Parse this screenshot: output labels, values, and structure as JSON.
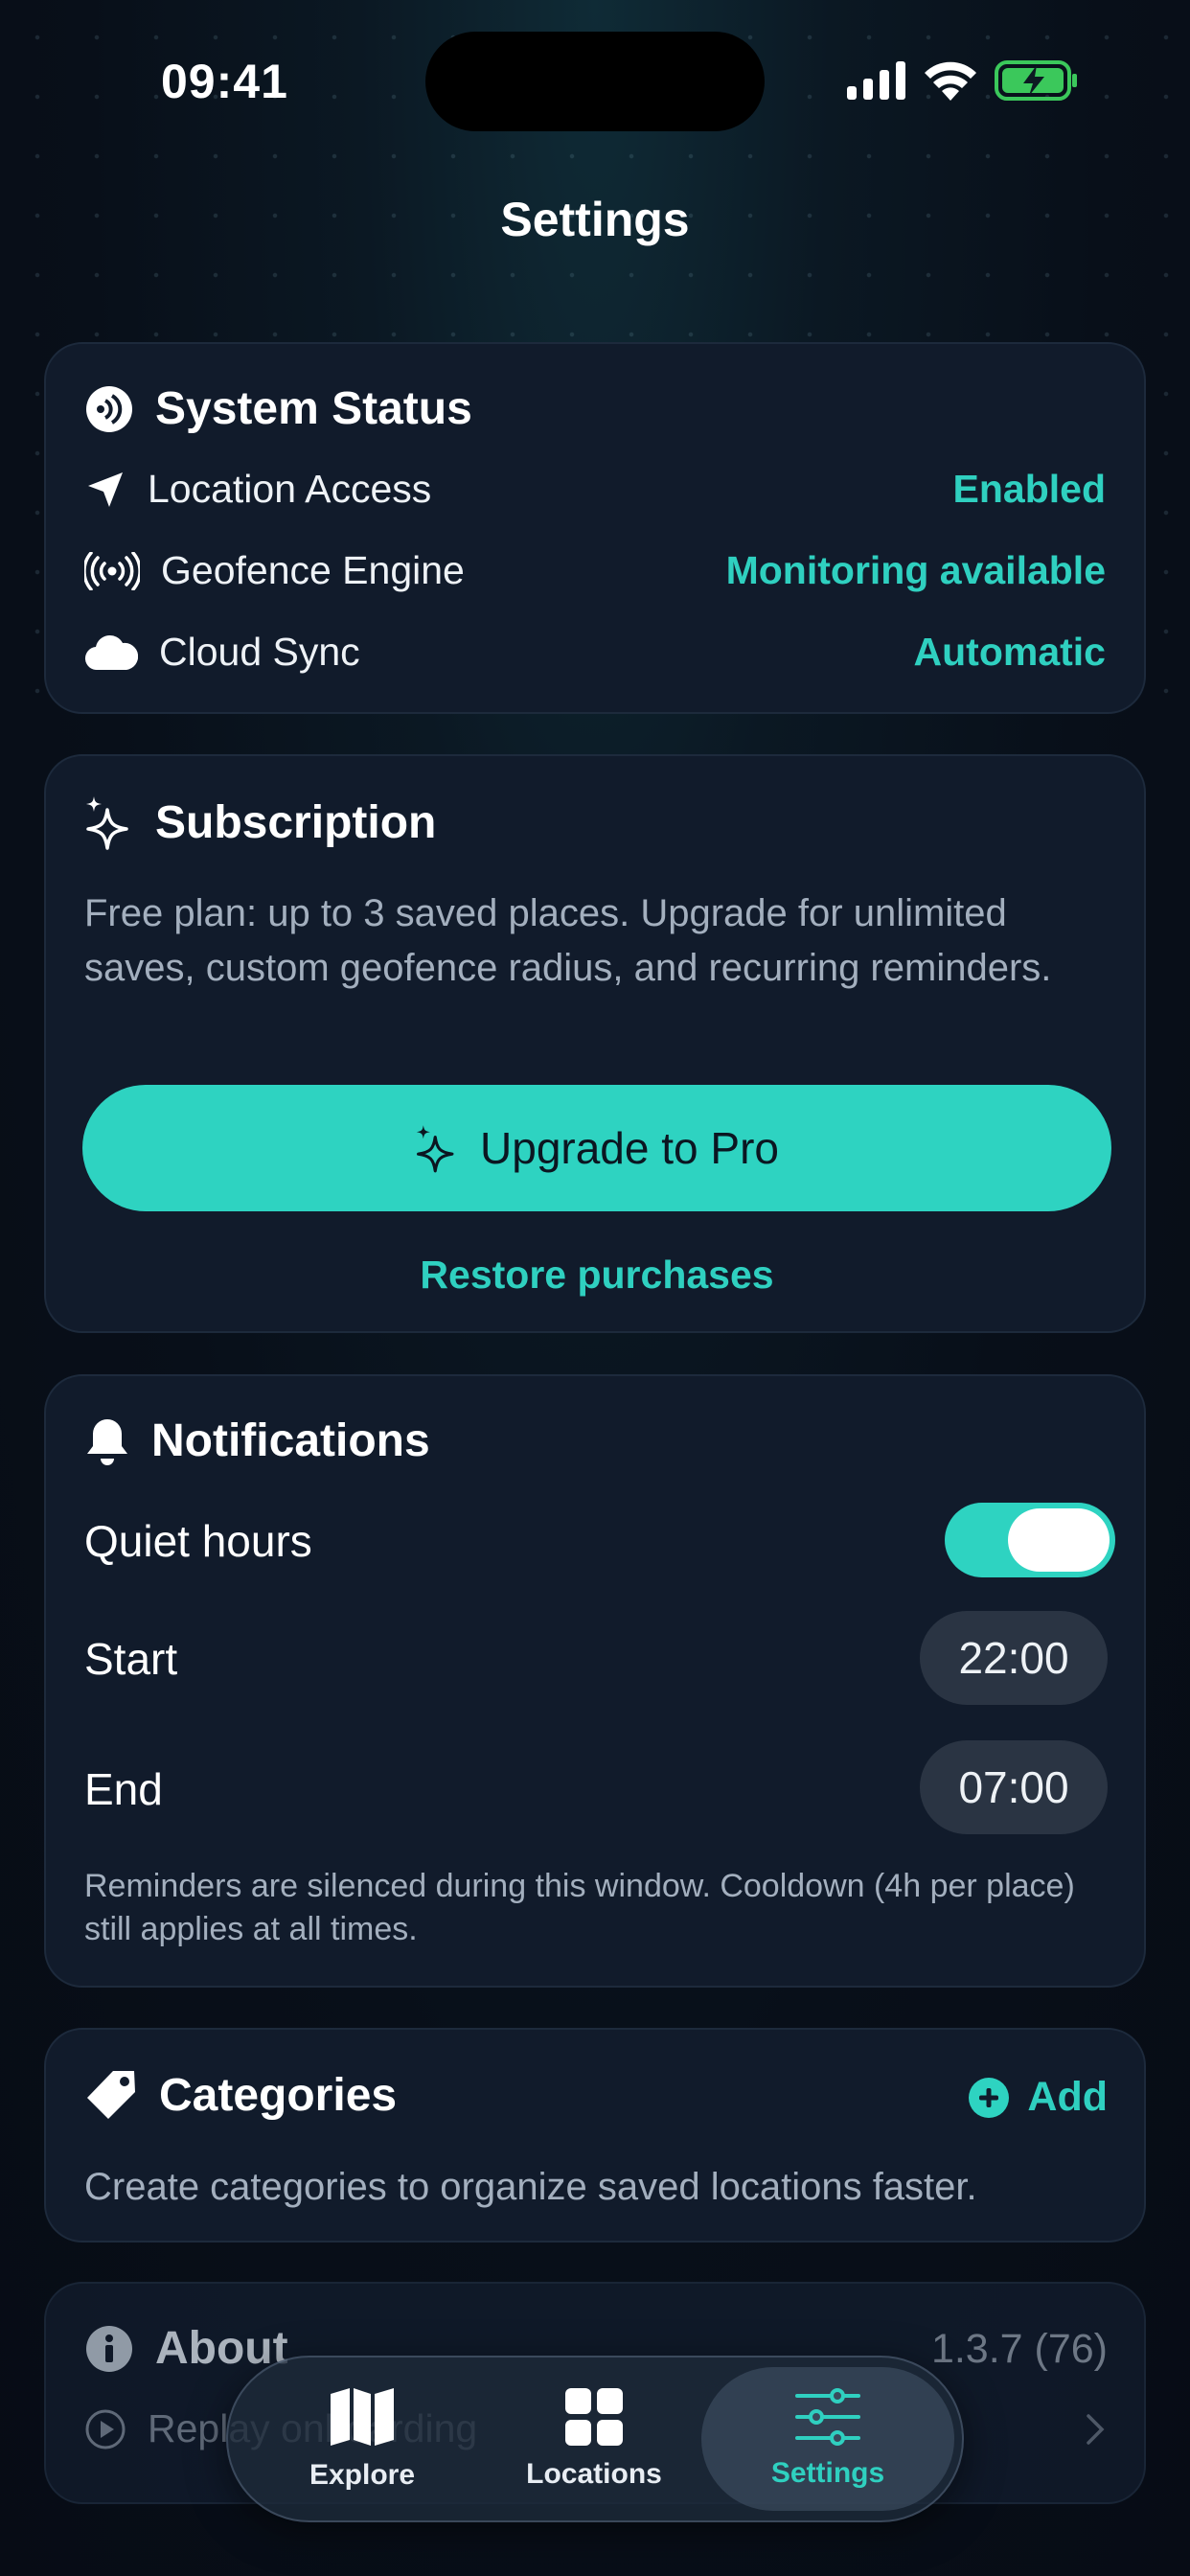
{
  "status_bar": {
    "time": "09:41"
  },
  "page": {
    "title": "Settings"
  },
  "system_status": {
    "title": "System Status",
    "rows": [
      {
        "label": "Location Access",
        "value": "Enabled",
        "icon": "location-arrow-icon"
      },
      {
        "label": "Geofence Engine",
        "value": "Monitoring available",
        "icon": "broadcast-icon"
      },
      {
        "label": "Cloud Sync",
        "value": "Automatic",
        "icon": "cloud-icon"
      }
    ]
  },
  "subscription": {
    "title": "Subscription",
    "description": "Free plan: up to 3 saved places. Upgrade for unlimited saves, custom geofence radius, and recurring reminders.",
    "upgrade_label": "Upgrade to Pro",
    "restore_label": "Restore purchases"
  },
  "notifications": {
    "title": "Notifications",
    "quiet_hours_label": "Quiet hours",
    "quiet_hours_enabled": true,
    "start_label": "Start",
    "start_value": "22:00",
    "end_label": "End",
    "end_value": "07:00",
    "note": "Reminders are silenced during this window. Cooldown (4h per place) still applies at all times."
  },
  "categories": {
    "title": "Categories",
    "add_label": "Add",
    "description": "Create categories to organize saved locations faster."
  },
  "about": {
    "title": "About",
    "version": "1.3.7 (76)",
    "replay_label": "Replay onboarding"
  },
  "tabbar": {
    "tabs": [
      {
        "label": "Explore",
        "icon": "map-icon",
        "active": false
      },
      {
        "label": "Locations",
        "icon": "grid-icon",
        "active": false
      },
      {
        "label": "Settings",
        "icon": "sliders-icon",
        "active": true
      }
    ]
  },
  "colors": {
    "accent": "#2ed3c1",
    "card": "#111b2b",
    "background": "#080f19"
  }
}
